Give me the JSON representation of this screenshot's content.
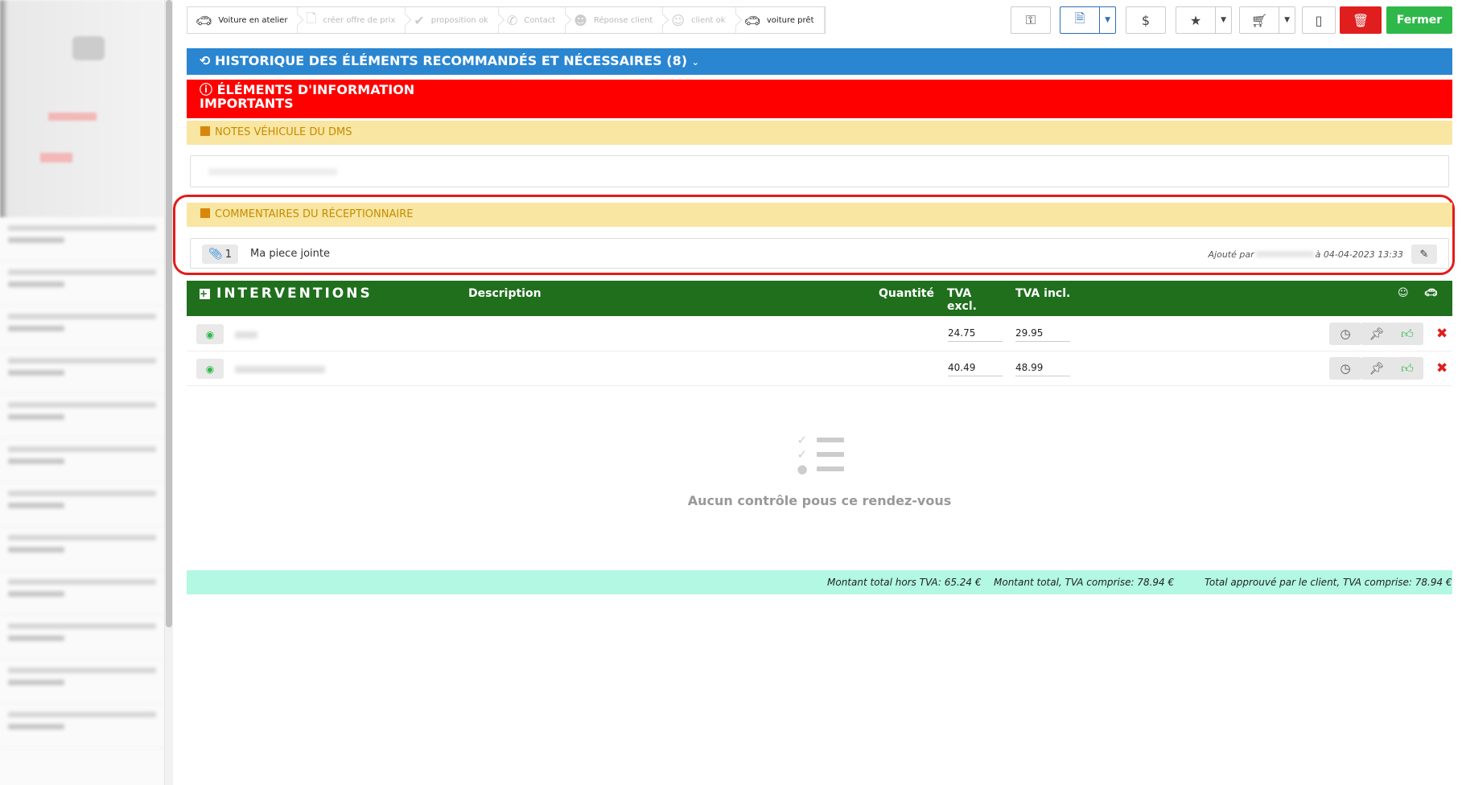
{
  "toolbar": {
    "steps": [
      {
        "label": "Voiture en atelier",
        "icon": "car-icon",
        "active": true
      },
      {
        "label": "créer offre de prix",
        "icon": "document-icon",
        "active": false
      },
      {
        "label": "proposition ok",
        "icon": "check-icon",
        "active": false
      },
      {
        "label": "Contact",
        "icon": "phone-icon",
        "active": false
      },
      {
        "label": "Réponse client",
        "icon": "user-check-icon",
        "active": false
      },
      {
        "label": "client ok",
        "icon": "smile-icon",
        "active": false
      },
      {
        "label": "voiture prêt",
        "icon": "car-icon",
        "active": true
      }
    ],
    "dollar_label": "$",
    "close_label": "Fermer"
  },
  "banners": {
    "history": "HISTORIQUE DES ÉLÉMENTS RECOMMANDÉS ET NÉCESSAIRES (8)",
    "info_line1": "ÉLÉMENTS D'INFORMATION",
    "info_line2": "IMPORTANTS"
  },
  "dms": {
    "title": "NOTES VÉHICULE DU DMS"
  },
  "comments": {
    "title": "COMMENTAIRES DU RÉCEPTIONNAIRE",
    "attachment_count": "1",
    "text": "Ma piece jointe",
    "added_by_label": "Ajouté par",
    "date": "à 04-04-2023 13:33"
  },
  "interventions": {
    "title": "INTERVENTIONS",
    "col_description": "Description",
    "col_quantity": "Quantité",
    "col_excl_1": "TVA",
    "col_excl_2": "excl.",
    "col_incl": "TVA incl.",
    "rows": [
      {
        "excl": "24.75",
        "incl": "29.95"
      },
      {
        "excl": "40.49",
        "incl": "48.99"
      }
    ]
  },
  "empty_state": {
    "text": "Aucun contrôle pous ce rendez-vous"
  },
  "totals": {
    "excl": "Montant total hors TVA: 65.24 €",
    "incl": "Montant total, TVA comprise: 78.94 €",
    "approved": "Total approuvé par le client, TVA comprise: 78.94 €"
  },
  "colors": {
    "history_blue": "#2a86d1",
    "info_red": "#ff0000",
    "note_yellow": "#f8e6a2",
    "interventions_green": "#1f6f1d",
    "totals_mint": "#b2f8e2",
    "close_green": "#2fb84a",
    "delete_red": "#e01e1e"
  }
}
